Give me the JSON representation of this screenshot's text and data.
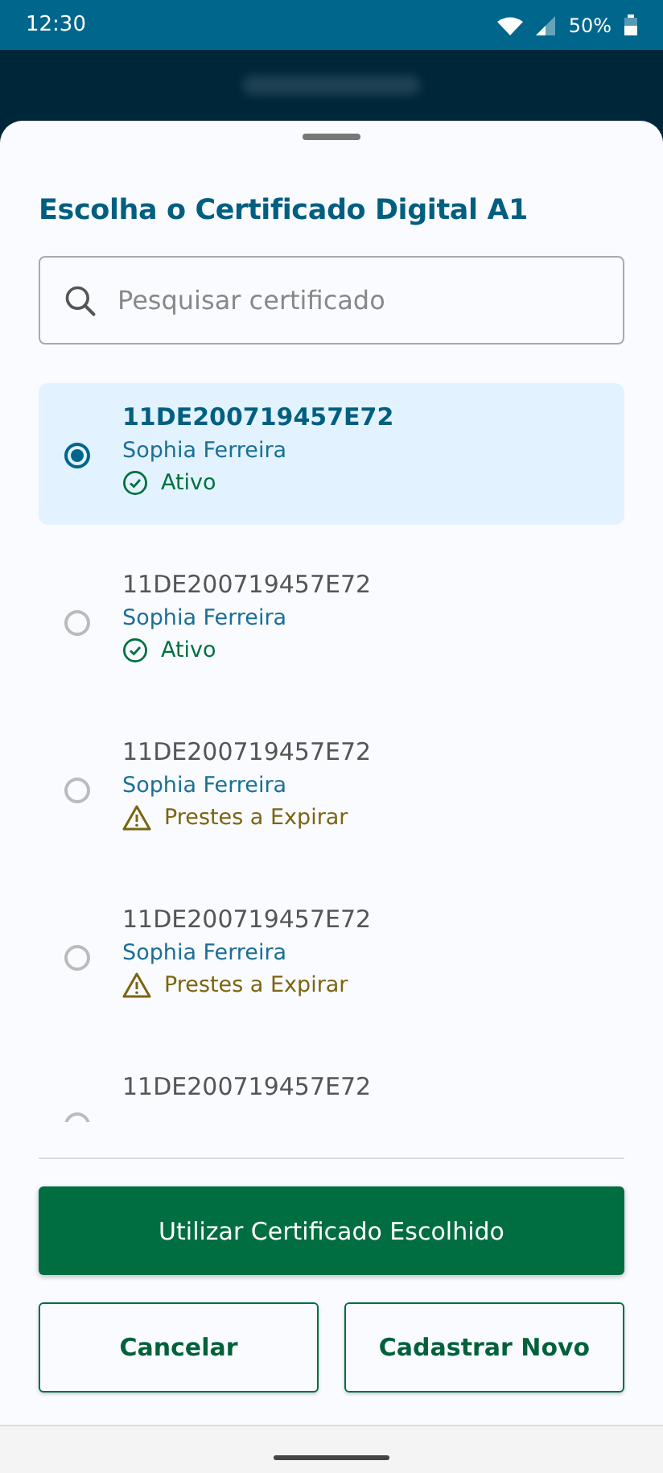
{
  "status_bar": {
    "time": "12:30",
    "battery": "50%"
  },
  "sheet": {
    "title": "Escolha o Certificado Digital A1",
    "search": {
      "placeholder": "Pesquisar certificado"
    },
    "certificates": [
      {
        "id": "11DE200719457E72",
        "holder": "Sophia Ferreira",
        "status": {
          "kind": "active",
          "text": "Ativo"
        },
        "selected": true
      },
      {
        "id": "11DE200719457E72",
        "holder": "Sophia Ferreira",
        "status": {
          "kind": "active",
          "text": "Ativo"
        },
        "selected": false
      },
      {
        "id": "11DE200719457E72",
        "holder": "Sophia Ferreira",
        "status": {
          "kind": "expiring",
          "text": "Prestes a Expirar"
        },
        "selected": false
      },
      {
        "id": "11DE200719457E72",
        "holder": "Sophia Ferreira",
        "status": {
          "kind": "expiring",
          "text": "Prestes a Expirar"
        },
        "selected": false
      },
      {
        "id": "11DE200719457E72",
        "selected": false
      }
    ],
    "primary_button": "Utilizar Certificado Escolhido",
    "secondary_buttons": [
      "Cancelar",
      "Cadastrar Novo"
    ]
  }
}
